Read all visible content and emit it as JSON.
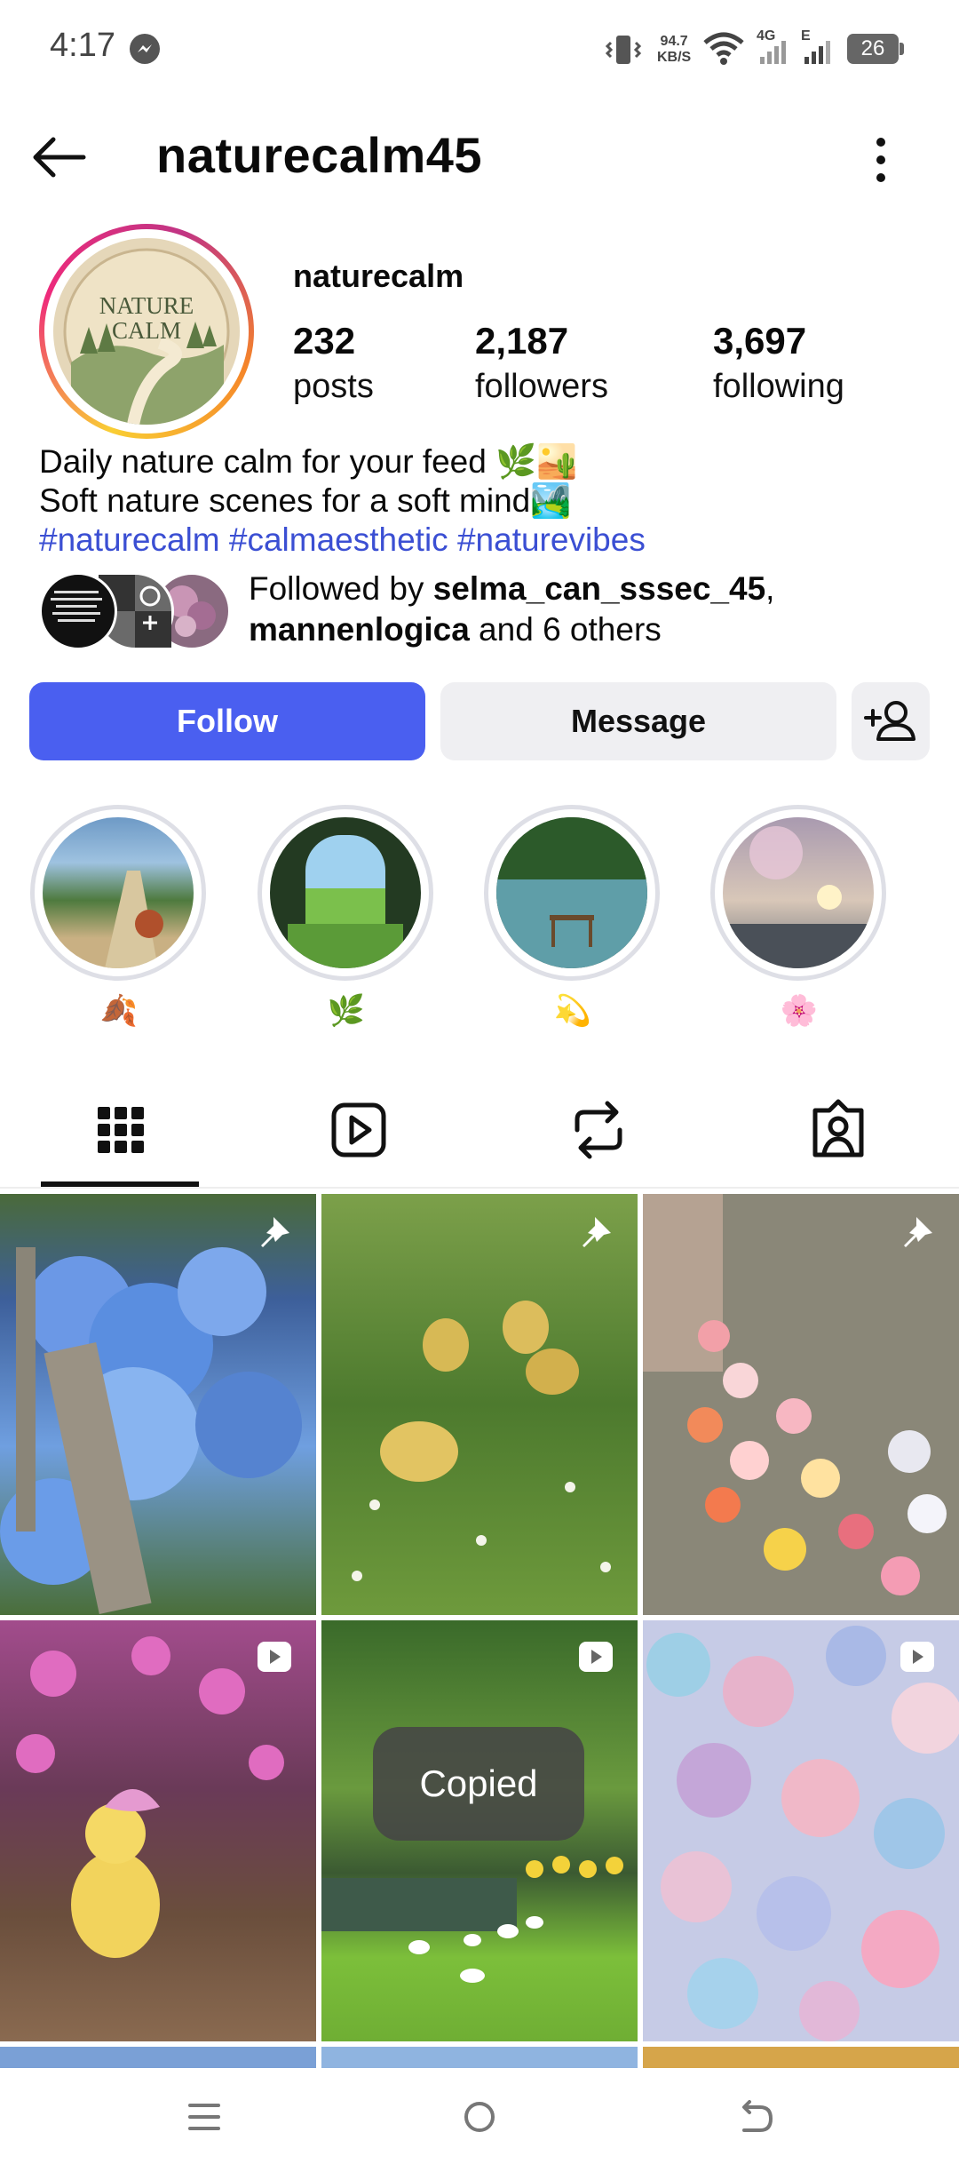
{
  "status": {
    "time": "4:17",
    "net_speed_top": "94.7",
    "net_speed_bottom": "KB/S",
    "net1": "4G",
    "net2": "E",
    "battery": "26"
  },
  "header": {
    "title": "naturecalm45"
  },
  "profile": {
    "avatar_text_line1": "NATURE",
    "avatar_text_line2": "CALM",
    "display_name": "naturecalm",
    "posts_count": "232",
    "posts_label": "posts",
    "followers_count": "2,187",
    "followers_label": "followers",
    "following_count": "3,697",
    "following_label": "following",
    "bio_line1": "Daily nature calm for your feed 🌿🏜️",
    "bio_line2": "Soft nature scenes for a soft mind🏞️",
    "hashtags": "#naturecalm #calmaesthetic #naturevibes",
    "followed_by_prefix": "Followed by ",
    "followed_user1": "selma_can_sssec_45",
    "followed_sep": ",",
    "followed_user2": "mannenlogica",
    "followed_suffix": " and 6 others"
  },
  "actions": {
    "follow": "Follow",
    "message": "Message"
  },
  "highlights": [
    {
      "label": "🍂"
    },
    {
      "label": "🌿"
    },
    {
      "label": "💫"
    },
    {
      "label": "🌸"
    }
  ],
  "tabs": [
    "grid-icon",
    "reels-icon",
    "reposts-icon",
    "tagged-icon"
  ],
  "toast": "Copied",
  "colors": {
    "accent": "#4a5ff0",
    "hashtag": "#3b4fd3"
  }
}
